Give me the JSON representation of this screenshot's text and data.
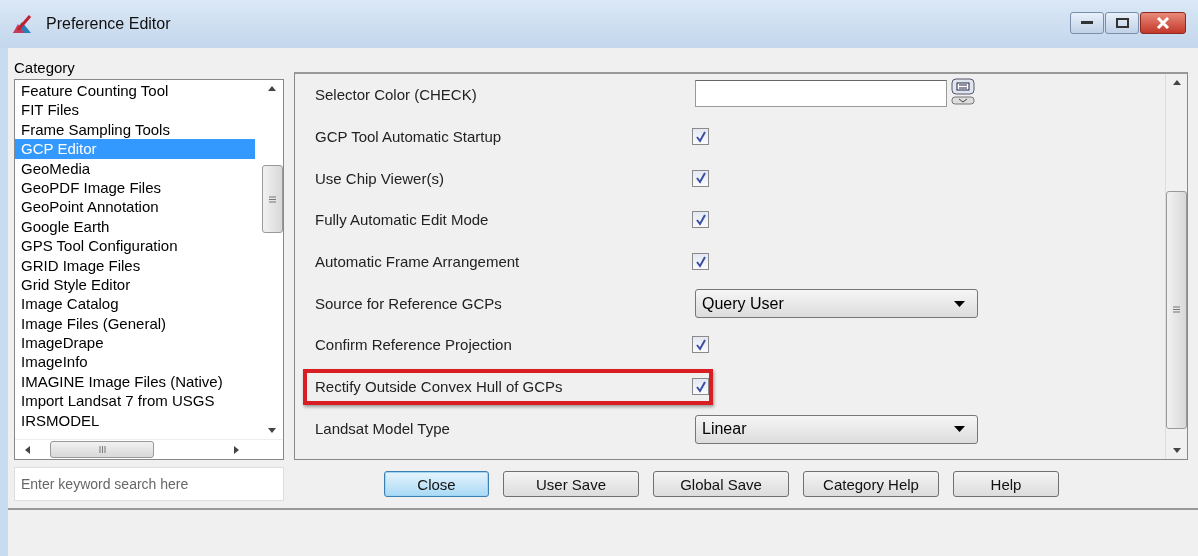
{
  "window": {
    "title": "Preference Editor"
  },
  "category": {
    "label": "Category",
    "items": [
      {
        "label": "Feature Counting Tool",
        "selected": false
      },
      {
        "label": "FIT Files",
        "selected": false
      },
      {
        "label": "Frame Sampling Tools",
        "selected": false
      },
      {
        "label": "GCP Editor",
        "selected": true
      },
      {
        "label": "GeoMedia",
        "selected": false
      },
      {
        "label": "GeoPDF Image Files",
        "selected": false
      },
      {
        "label": "GeoPoint Annotation",
        "selected": false
      },
      {
        "label": "Google Earth",
        "selected": false
      },
      {
        "label": "GPS Tool Configuration",
        "selected": false
      },
      {
        "label": "GRID Image Files",
        "selected": false
      },
      {
        "label": "Grid Style Editor",
        "selected": false
      },
      {
        "label": "Image Catalog",
        "selected": false
      },
      {
        "label": "Image Files (General)",
        "selected": false
      },
      {
        "label": "ImageDrape",
        "selected": false
      },
      {
        "label": "ImageInfo",
        "selected": false
      },
      {
        "label": "IMAGINE Image Files (Native)",
        "selected": false
      },
      {
        "label": "Import Landsat 7 from USGS",
        "selected": false
      },
      {
        "label": "IRSMODEL",
        "selected": false
      }
    ]
  },
  "settings": [
    {
      "kind": "color",
      "label": "Selector Color (CHECK)",
      "highlighted": false
    },
    {
      "kind": "checkbox",
      "label": "GCP Tool Automatic Startup",
      "checked": true,
      "highlighted": false
    },
    {
      "kind": "checkbox",
      "label": "Use Chip Viewer(s)",
      "checked": true,
      "highlighted": false
    },
    {
      "kind": "checkbox",
      "label": "Fully Automatic Edit Mode",
      "checked": true,
      "highlighted": false
    },
    {
      "kind": "checkbox",
      "label": "Automatic Frame Arrangement",
      "checked": true,
      "highlighted": false
    },
    {
      "kind": "dropdown",
      "label": "Source for Reference GCPs",
      "value": "Query User",
      "highlighted": false
    },
    {
      "kind": "checkbox",
      "label": "Confirm Reference Projection",
      "checked": true,
      "highlighted": false
    },
    {
      "kind": "checkbox",
      "label": "Rectify Outside Convex Hull of GCPs",
      "checked": true,
      "highlighted": true
    },
    {
      "kind": "dropdown",
      "label": "Landsat Model Type",
      "value": "Linear",
      "highlighted": false
    }
  ],
  "search": {
    "placeholder": "Enter keyword search here"
  },
  "buttons": [
    {
      "label": "Close",
      "focused": true
    },
    {
      "label": "User Save",
      "focused": false
    },
    {
      "label": "Global Save",
      "focused": false
    },
    {
      "label": "Category Help",
      "focused": false
    },
    {
      "label": "Help",
      "focused": false
    }
  ]
}
